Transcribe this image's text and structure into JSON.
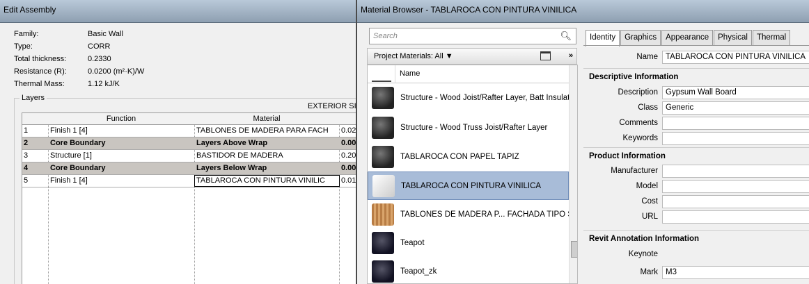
{
  "edit_assembly": {
    "title": "Edit Assembly",
    "props": [
      {
        "key": "Family:",
        "value": "Basic Wall"
      },
      {
        "key": "Type:",
        "value": "CORR"
      },
      {
        "key": "Total thickness:",
        "value": "0.2330"
      },
      {
        "key": "Resistance (R):",
        "value": "0.0200 (m²·K)/W"
      },
      {
        "key": "Thermal Mass:",
        "value": "1.12 kJ/K"
      }
    ],
    "layers_label": "Layers",
    "exterior_label": "EXTERIOR SIDE",
    "columns": [
      "Function",
      "Material"
    ],
    "rows": [
      {
        "num": "1",
        "function": "Finish 1 [4]",
        "material": "TABLONES DE MADERA PARA FACH",
        "thickness": "0.02"
      },
      {
        "num": "2",
        "function": "Core Boundary",
        "material": "Layers Above Wrap",
        "thickness": "0.00"
      },
      {
        "num": "3",
        "function": "Structure [1]",
        "material": "BASTIDOR DE MADERA",
        "thickness": "0.20"
      },
      {
        "num": "4",
        "function": "Core Boundary",
        "material": "Layers Below Wrap",
        "thickness": "0.00"
      },
      {
        "num": "5",
        "function": "Finish 1 [4]",
        "material": "TABLAROCA CON PINTURA VINILIC",
        "thickness": "0.01"
      }
    ]
  },
  "material_browser": {
    "title": "Material Browser - TABLAROCA CON PINTURA VINILICA",
    "search_placeholder": "Search",
    "project_materials": "Project Materials: All ▼",
    "list_header": "Name",
    "items": [
      {
        "name": "Structure - Wood Joist/Rafter Layer, Batt Insulation",
        "thumb": "dark"
      },
      {
        "name": "Structure - Wood Truss Joist/Rafter Layer",
        "thumb": "dark"
      },
      {
        "name": "TABLAROCA CON PAPEL TAPIZ",
        "thumb": "dark"
      },
      {
        "name": "TABLAROCA CON PINTURA VINILICA",
        "thumb": "white"
      },
      {
        "name": "TABLONES DE MADERA P... FACHADA TIPO SIDING",
        "thumb": "wood"
      },
      {
        "name": "Teapot",
        "thumb": "teapot"
      },
      {
        "name": "Teapot_zk",
        "thumb": "teapot"
      }
    ],
    "tabs": [
      "Identity",
      "Graphics",
      "Appearance",
      "Physical",
      "Thermal"
    ],
    "name_label": "Name",
    "name_value": "TABLAROCA CON PINTURA VINILICA",
    "sections": {
      "descriptive": "Descriptive Information",
      "product": "Product Information",
      "annotation": "Revit Annotation Information"
    },
    "fields": {
      "description": {
        "label": "Description",
        "value": "Gypsum Wall Board"
      },
      "class": {
        "label": "Class",
        "value": "Generic"
      },
      "comments": {
        "label": "Comments",
        "value": ""
      },
      "keywords": {
        "label": "Keywords",
        "value": ""
      },
      "manufacturer": {
        "label": "Manufacturer",
        "value": ""
      },
      "model": {
        "label": "Model",
        "value": ""
      },
      "cost": {
        "label": "Cost",
        "value": ""
      },
      "url": {
        "label": "URL",
        "value": ""
      },
      "keynote": {
        "label": "Keynote",
        "value": ""
      },
      "mark": {
        "label": "Mark",
        "value": "M3"
      }
    }
  }
}
